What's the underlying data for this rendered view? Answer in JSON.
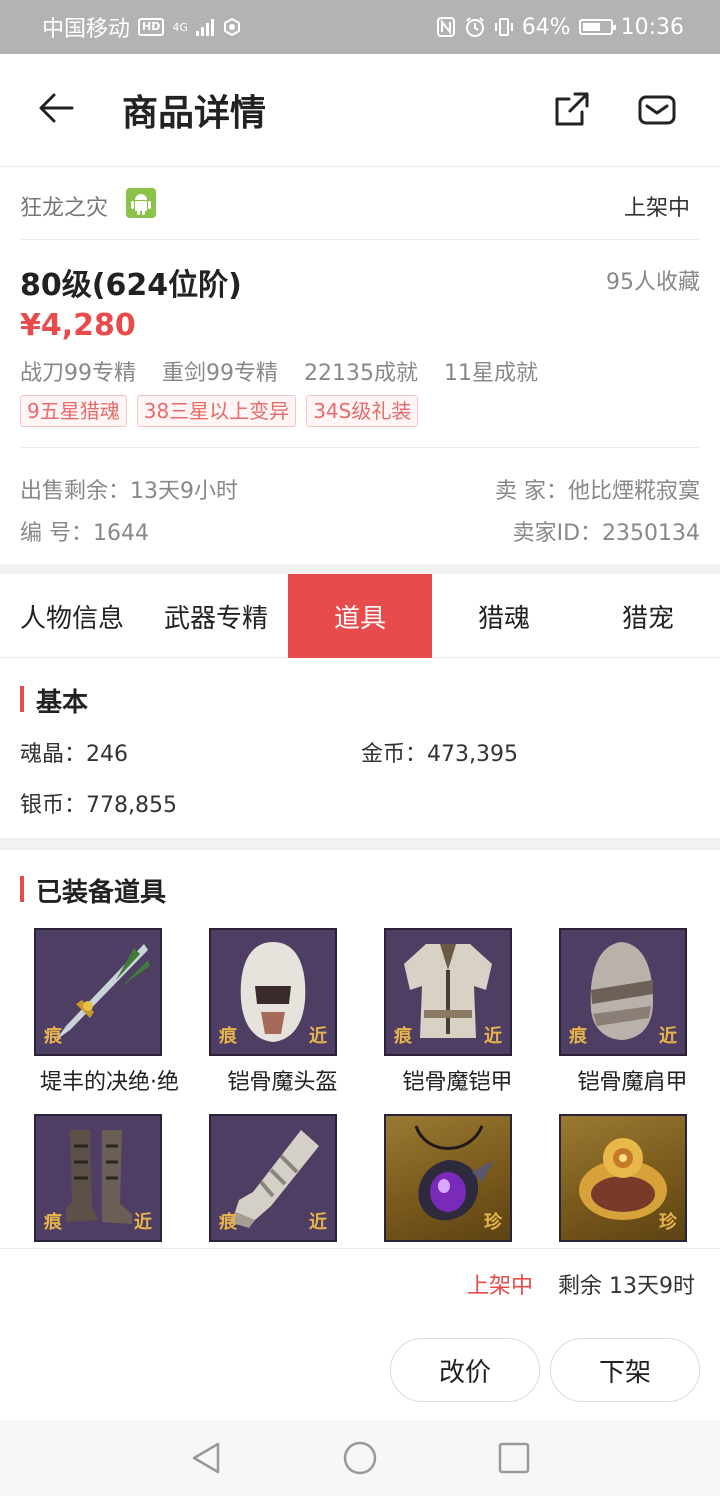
{
  "status_bar": {
    "carrier": "中国移动",
    "hd_badge": "HD",
    "network": "4G",
    "battery": "64%",
    "battery_level": 0.64,
    "time": "10:36"
  },
  "header": {
    "title": "商品详情"
  },
  "listing": {
    "game": "狂龙之灾",
    "status": "上架中",
    "level_title": "80级(624位阶)",
    "favorites": "95人收藏",
    "price": "¥4,280",
    "tags": [
      "战刀99专精",
      "重剑99专精",
      "22135成就",
      "11星成就"
    ],
    "badges": [
      "9五星猎魂",
      "38三星以上变异",
      "34S级礼装"
    ],
    "remaining_label": "出售剩余：13天9小时",
    "seller_label": "卖  家：他比煙糀寂寞",
    "number_label": "编  号：1644",
    "seller_id_label": "卖家ID：2350134"
  },
  "tabs": [
    {
      "label": "人物信息",
      "active": false
    },
    {
      "label": "武器专精",
      "active": false
    },
    {
      "label": "道具",
      "active": true
    },
    {
      "label": "猎魂",
      "active": false
    },
    {
      "label": "猎宠",
      "active": false
    }
  ],
  "basic": {
    "title": "基本",
    "soul_crystal": "魂晶：246",
    "gold": "金币：473,395",
    "silver": "银币：778,855"
  },
  "equipped": {
    "title": "已装备道具",
    "items": [
      {
        "name": "堤丰的决绝·绝",
        "icon": "sword-icon",
        "tag_left": "痕",
        "tag_right": "",
        "frame": "purple"
      },
      {
        "name": "铠骨魔头盔",
        "icon": "helmet-icon",
        "tag_left": "痕",
        "tag_right": "近",
        "frame": "purple"
      },
      {
        "name": "铠骨魔铠甲",
        "icon": "armor-icon",
        "tag_left": "痕",
        "tag_right": "近",
        "frame": "purple"
      },
      {
        "name": "铠骨魔肩甲",
        "icon": "shoulder-armor-icon",
        "tag_left": "痕",
        "tag_right": "近",
        "frame": "purple"
      },
      {
        "name": "",
        "icon": "boots-icon",
        "tag_left": "痕",
        "tag_right": "近",
        "frame": "purple"
      },
      {
        "name": "",
        "icon": "gauntlet-icon",
        "tag_left": "痕",
        "tag_right": "近",
        "frame": "purple"
      },
      {
        "name": "",
        "icon": "amulet-icon",
        "tag_left": "",
        "tag_right": "珍",
        "frame": "gold"
      },
      {
        "name": "",
        "icon": "bracelet-icon",
        "tag_left": "",
        "tag_right": "珍",
        "frame": "gold"
      }
    ]
  },
  "footer": {
    "status": "上架中",
    "remaining": "剩余 13天9时",
    "change_price": "改价",
    "delist": "下架"
  }
}
